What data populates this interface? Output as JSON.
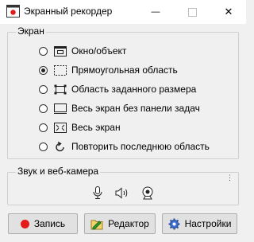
{
  "window": {
    "title": "Экранный рекордер",
    "min_glyph": "—",
    "close_glyph": "✕"
  },
  "screen_group": {
    "label": "Экран",
    "options": [
      {
        "label": "Окно/объект",
        "icon": "window-object-icon",
        "checked": false
      },
      {
        "label": "Прямоугольная область",
        "icon": "dashed-rectangle-icon",
        "checked": true
      },
      {
        "label": "Область заданного размера",
        "icon": "fixed-size-area-icon",
        "checked": false
      },
      {
        "label": "Весь экран без панели задач",
        "icon": "screen-no-taskbar-icon",
        "checked": false
      },
      {
        "label": "Весь экран",
        "icon": "fullscreen-icon",
        "checked": false
      },
      {
        "label": "Повторить последнюю область",
        "icon": "repeat-area-icon",
        "checked": false
      }
    ]
  },
  "audio_group": {
    "label": "Звук и веб-камера",
    "more_glyph": "·\n·\n·",
    "icons": [
      "microphone-icon",
      "speaker-icon",
      "webcam-icon"
    ]
  },
  "buttons": {
    "record": "Запись",
    "editor": "Редактор",
    "settings": "Настройки"
  },
  "colors": {
    "record_dot": "#e31b1b",
    "editor_icon": "#2f9a2f",
    "settings_icon": "#3b6fd1"
  }
}
